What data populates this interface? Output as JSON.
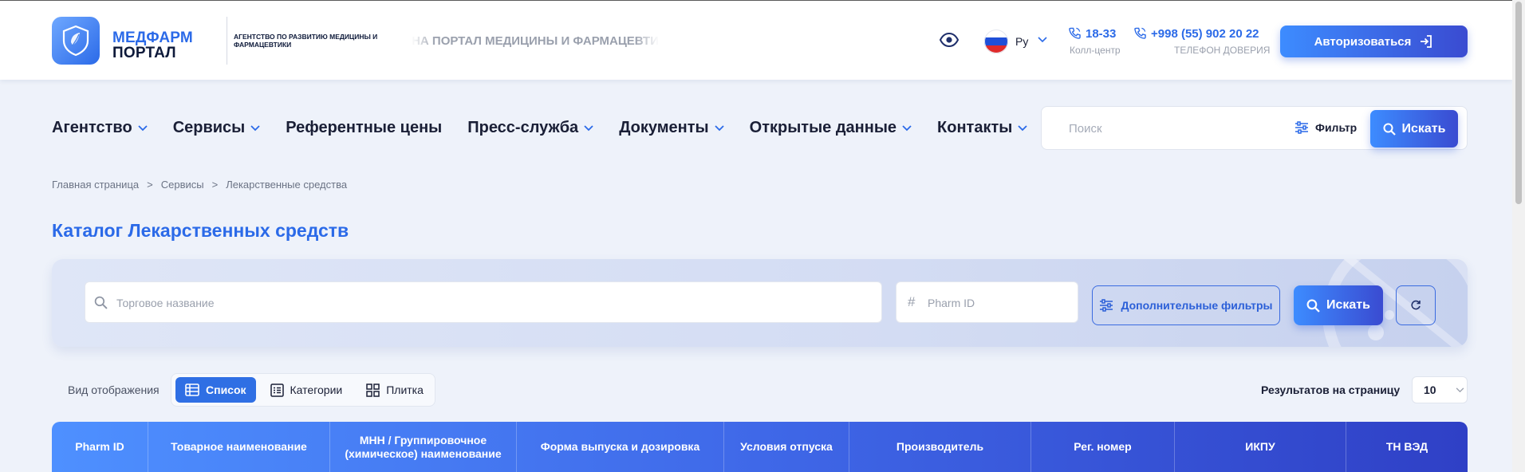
{
  "header": {
    "logo_line1": "МЕДФАРМ",
    "logo_line2": "ПОРТАЛ",
    "agency_text": "АГЕНТСТВО ПО РАЗВИТИЮ МЕДИЦИНЫ И ФАРМАЦЕВТИКИ",
    "marquee_text": "ДОБРО ПОЖАЛОВАТЬ НА ПОРТАЛ МЕДИЦИНЫ И ФАРМАЦЕВТИКИ",
    "language": "Ру",
    "call_center_number": "18-33",
    "call_center_label": "Колл-центр",
    "trust_phone_number": "+998 (55) 902 20 22",
    "trust_phone_label": "ТЕЛЕФОН ДОВЕРИЯ",
    "auth_button": "Авторизоваться"
  },
  "nav": {
    "items": [
      {
        "label": "Агентство",
        "has_dropdown": true
      },
      {
        "label": "Сервисы",
        "has_dropdown": true
      },
      {
        "label": "Референтные цены",
        "has_dropdown": false
      },
      {
        "label": "Пресс-служба",
        "has_dropdown": true
      },
      {
        "label": "Документы",
        "has_dropdown": true
      },
      {
        "label": "Открытые данные",
        "has_dropdown": true
      },
      {
        "label": "Контакты",
        "has_dropdown": true
      }
    ],
    "search_placeholder": "Поиск",
    "filter_label": "Фильтр",
    "search_button": "Искать"
  },
  "breadcrumb": {
    "items": [
      "Главная страница",
      "Сервисы",
      "Лекарственные средства"
    ],
    "separator": ">"
  },
  "page_title": "Каталог Лекарственных средств",
  "filters": {
    "trade_name_placeholder": "Торговое название",
    "pharm_id_placeholder": "Pharm ID",
    "hash_symbol": "#",
    "advanced_filters_button": "Дополнительные фильтры",
    "search_button": "Искать"
  },
  "view": {
    "label": "Вид отображения",
    "options": [
      "Список",
      "Категории",
      "Плитка"
    ],
    "active": "Список",
    "per_page_label": "Результатов на страницу",
    "per_page_value": "10"
  },
  "table": {
    "columns": [
      "Pharm ID",
      "Товарное наименование",
      "МНН / Группировочное (химическое) наименование",
      "Форма выпуска и дозировка",
      "Условия отпуска",
      "Производитель",
      "Рег. номер",
      "ИКПУ",
      "ТН ВЭД"
    ]
  },
  "colors": {
    "accent": "#2b6ae8",
    "button_gradient_start": "#3d8cff",
    "button_gradient_end": "#3a4bd1",
    "page_bg": "#eef2fa"
  }
}
